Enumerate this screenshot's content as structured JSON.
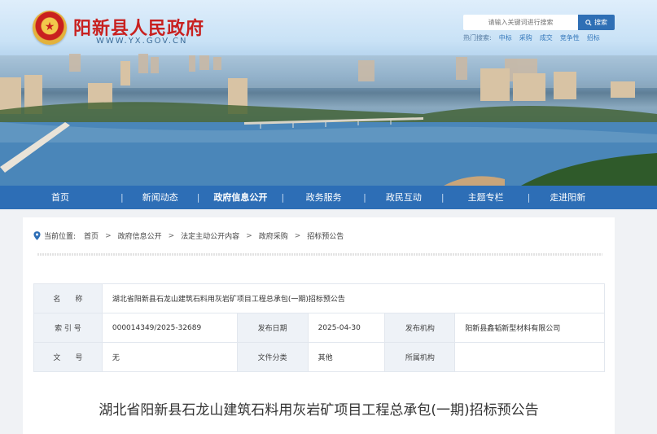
{
  "header": {
    "site_title": "阳新县人民政府",
    "site_domain": "WWW.YX.GOV.CN",
    "search": {
      "placeholder": "请输入关键词进行搜索",
      "button_label": "搜索"
    },
    "hot_search": {
      "label": "热门搜索:",
      "keywords": [
        "中标",
        "采购",
        "成交",
        "竞争性",
        "招标"
      ]
    }
  },
  "nav": {
    "items": [
      "首页",
      "新闻动态",
      "政府信息公开",
      "政务服务",
      "政民互动",
      "主题专栏",
      "走进阳新"
    ],
    "active_index": 2
  },
  "breadcrumb": {
    "label": "当前位置:",
    "items": [
      "首页",
      "政府信息公开",
      "法定主动公开内容",
      "政府采购",
      "招标预公告"
    ]
  },
  "meta_table": {
    "name_label": "名　　称",
    "name_value": "湖北省阳新县石龙山建筑石料用灰岩矿项目工程总承包(一期)招标预公告",
    "index_label": "索 引 号",
    "index_value": "000014349/2025-32689",
    "date_label": "发布日期",
    "date_value": "2025-04-30",
    "publisher_label": "发布机构",
    "publisher_value": "阳新县鑫韬新型材料有限公司",
    "docno_label": "文　　号",
    "docno_value": "无",
    "category_label": "文件分类",
    "category_value": "其他",
    "org_label": "所属机构",
    "org_value": ""
  },
  "article": {
    "title": "湖北省阳新县石龙山建筑石料用灰岩矿项目工程总承包(一期)招标预公告"
  },
  "colors": {
    "nav_bg": "#2d6eb6",
    "title_red": "#c8201f",
    "search_btn": "#2f6fb5"
  }
}
